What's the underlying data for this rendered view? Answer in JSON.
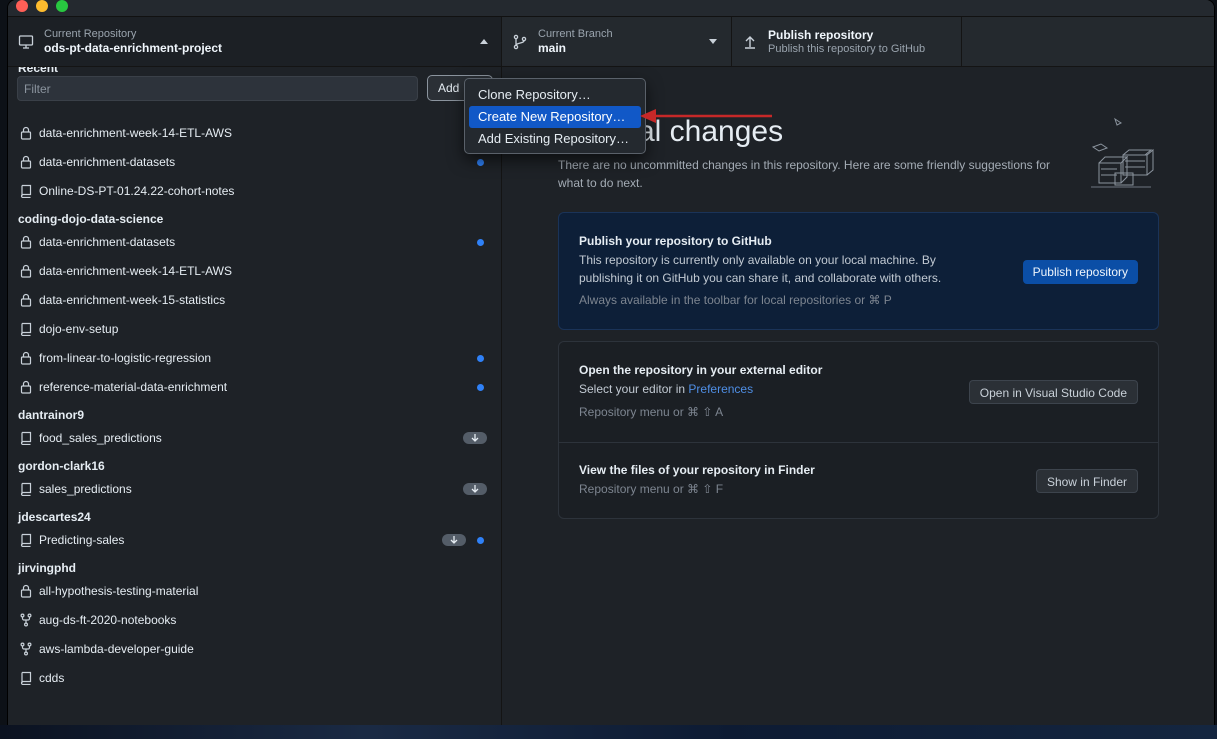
{
  "toolbar": {
    "repo_label": "Current Repository",
    "repo_name": "ods-pt-data-enrichment-project",
    "branch_label": "Current Branch",
    "branch_name": "main",
    "publish_title": "Publish repository",
    "publish_subtitle": "Publish this repository to GitHub"
  },
  "sidebar": {
    "filter_placeholder": "Filter",
    "add_label": "Add",
    "recent_header": "Recent",
    "recent": [
      {
        "name": "data-enrichment-week-14-ETL-AWS",
        "icon": "lock-icon"
      },
      {
        "name": "data-enrichment-datasets",
        "icon": "lock-icon"
      },
      {
        "name": "Online-DS-PT-01.24.22-cohort-notes",
        "icon": "repo-icon"
      }
    ],
    "groups": [
      {
        "header": "coding-dojo-data-science",
        "items": [
          {
            "name": "data-enrichment-datasets",
            "icon": "lock-icon"
          },
          {
            "name": "data-enrichment-week-14-ETL-AWS",
            "icon": "lock-icon"
          },
          {
            "name": "data-enrichment-week-15-statistics",
            "icon": "lock-icon"
          },
          {
            "name": "dojo-env-setup",
            "icon": "repo-icon"
          },
          {
            "name": "from-linear-to-logistic-regression",
            "icon": "lock-icon"
          },
          {
            "name": "reference-material-data-enrichment",
            "icon": "lock-icon"
          }
        ]
      },
      {
        "header": "dantrainor9",
        "items": [
          {
            "name": "food_sales_predictions",
            "icon": "repo-icon"
          }
        ]
      },
      {
        "header": "gordon-clark16",
        "items": [
          {
            "name": "sales_predictions",
            "icon": "repo-icon"
          }
        ]
      },
      {
        "header": "jdescartes24",
        "items": [
          {
            "name": "Predicting-sales",
            "icon": "repo-icon"
          }
        ]
      },
      {
        "header": "jirvingphd",
        "items": [
          {
            "name": "all-hypothesis-testing-material",
            "icon": "lock-icon"
          },
          {
            "name": "aug-ds-ft-2020-notebooks",
            "icon": "fork-icon"
          },
          {
            "name": "aws-lambda-developer-guide",
            "icon": "fork-icon"
          },
          {
            "name": "cdds",
            "icon": "repo-icon"
          }
        ]
      }
    ]
  },
  "menu": {
    "items": [
      "Clone Repository…",
      "Create New Repository…",
      "Add Existing Repository…"
    ],
    "active_index": 1
  },
  "main": {
    "heading": "No local changes",
    "heading_visible": "cal changes",
    "subtext": "There are no uncommitted changes in this repository. Here are some friendly suggestions for what to do next.",
    "publish_card": {
      "title": "Publish your repository to GitHub",
      "description": "This repository is currently only available on your local machine. By publishing it on GitHub you can share it, and collaborate with others.",
      "hint": "Always available in the toolbar for local repositories or  ⌘  P",
      "button": "Publish repository"
    },
    "editor_card": {
      "title": "Open the repository in your external editor",
      "desc_prefix": "Select your editor in ",
      "desc_link": "Preferences",
      "hint": "Repository menu or  ⌘  ⇧  A",
      "button": "Open in Visual Studio Code"
    },
    "finder_card": {
      "title": "View the files of your repository in Finder",
      "hint": "Repository menu or  ⌘  ⇧  F",
      "button": "Show in Finder"
    }
  },
  "colors": {
    "accent": "#1158c7",
    "dot": "#2f81f7",
    "annotation_arrow": "#c62828"
  }
}
